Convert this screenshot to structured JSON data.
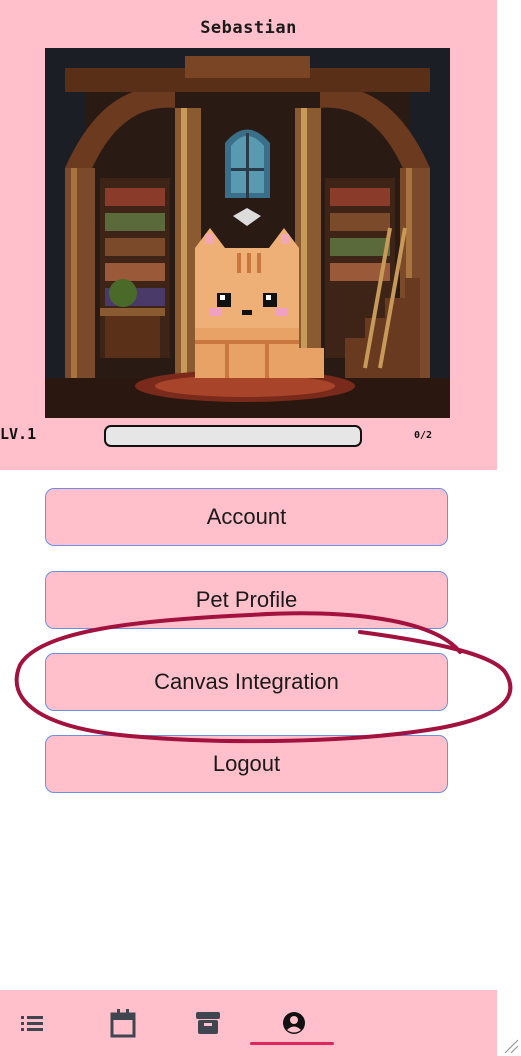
{
  "pet": {
    "name": "Sebastian",
    "level_label": "LV.1",
    "xp_text": "0/2",
    "xp_progress": 0
  },
  "menu": {
    "account_label": "Account",
    "pet_profile_label": "Pet Profile",
    "canvas_label": "Canvas Integration",
    "logout_label": "Logout"
  },
  "annotation": {
    "color": "#a3123e",
    "target": "canvas-integration-button"
  },
  "nav": {
    "items": [
      {
        "icon": "list-icon",
        "active": false
      },
      {
        "icon": "calendar-icon",
        "active": false
      },
      {
        "icon": "archive-icon",
        "active": false
      },
      {
        "icon": "user-circle-icon",
        "active": true
      }
    ],
    "active_color": "#e0245e",
    "background": "#ffc0cb"
  },
  "colors": {
    "panel_bg": "#ffc0cb",
    "button_border": "#6b8fe6"
  }
}
